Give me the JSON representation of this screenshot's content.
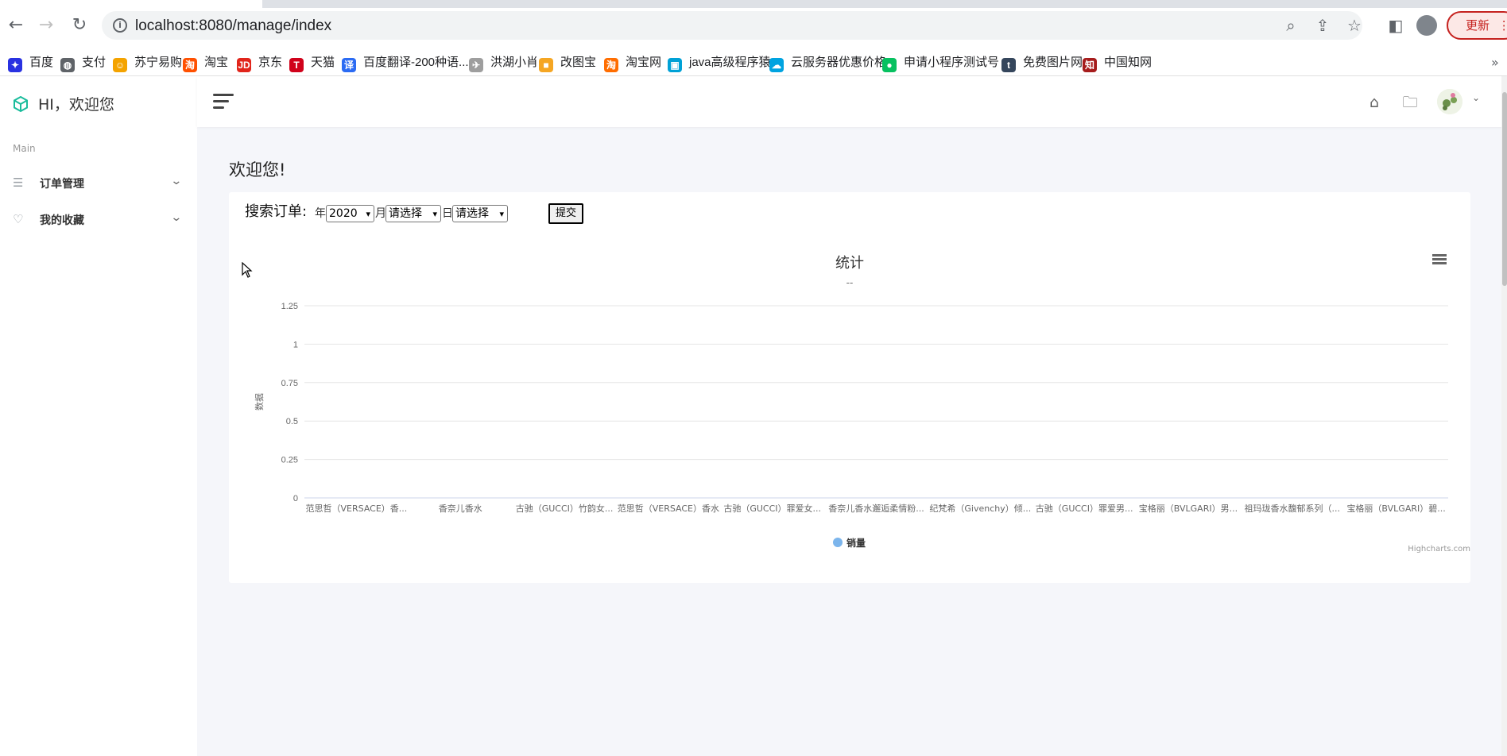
{
  "browser": {
    "url": "localhost:8080/manage/index",
    "update_label": "更新"
  },
  "bookmarks": [
    {
      "label": "百度",
      "icon": "baidu-icon",
      "color": "#2932e1",
      "glyph": "✦"
    },
    {
      "label": "支付",
      "icon": "globe-icon",
      "color": "#5f6368",
      "glyph": "◍"
    },
    {
      "label": "苏宁易购",
      "icon": "suning-icon",
      "color": "#f4a300",
      "glyph": "☺"
    },
    {
      "label": "淘宝",
      "icon": "taobao-icon",
      "color": "#ff5000",
      "glyph": "淘"
    },
    {
      "label": "京东",
      "icon": "jd-icon",
      "color": "#e1251b",
      "glyph": "JD"
    },
    {
      "label": "天猫",
      "icon": "tmall-icon",
      "color": "#d0021b",
      "glyph": "T"
    },
    {
      "label": "百度翻译-200种语...",
      "icon": "translate-icon",
      "color": "#2b6bf3",
      "glyph": "译"
    },
    {
      "label": "洪湖小肖",
      "icon": "bird-icon",
      "color": "#9e9e9e",
      "glyph": "✈"
    },
    {
      "label": "改图宝",
      "icon": "gaitubao-icon",
      "color": "#f5a623",
      "glyph": "■"
    },
    {
      "label": "淘宝网",
      "icon": "taobao-net-icon",
      "color": "#ff6d00",
      "glyph": "淘"
    },
    {
      "label": "java高级程序猿",
      "icon": "bilibili-icon",
      "color": "#00a1d6",
      "glyph": "▣"
    },
    {
      "label": "云服务器优惠价格",
      "icon": "cloud-icon",
      "color": "#00a3e0",
      "glyph": "☁"
    },
    {
      "label": "申请小程序测试号",
      "icon": "wechat-icon",
      "color": "#07c160",
      "glyph": "●"
    },
    {
      "label": "免费图片网",
      "icon": "tumblr-icon",
      "color": "#35465c",
      "glyph": "t"
    },
    {
      "label": "中国知网",
      "icon": "cnki-icon",
      "color": "#a61c1c",
      "glyph": "知"
    }
  ],
  "sidebar": {
    "brand": "HI，欢迎您",
    "section": "Main",
    "items": [
      {
        "label": "订单管理"
      },
      {
        "label": "我的收藏"
      }
    ]
  },
  "main": {
    "welcome": "欢迎您!",
    "search": {
      "label": "搜索订单:",
      "year_label": "年",
      "year_value": "2020",
      "month_label": "月",
      "month_value": "请选择",
      "day_label": "日",
      "day_value": "请选择",
      "submit_label": "提交"
    }
  },
  "chart_data": {
    "type": "bar",
    "title": "统计",
    "subtitle": "--",
    "ylabel": "数据",
    "xlabel": "",
    "ylim": [
      0,
      1.25
    ],
    "yticks": [
      "0",
      "0.25",
      "0.5",
      "0.75",
      "1",
      "1.25"
    ],
    "categories": [
      "范思哲（VERSACE）香...",
      "香奈儿香水",
      "古驰（GUCCI）竹韵女...",
      "范思哲（VERSACE）香水",
      "古驰（GUCCI）罪爱女...",
      "香奈儿香水邂逅柔情粉...",
      "纪梵希（Givenchy）倾...",
      "古驰（GUCCI）罪爱男...",
      "宝格丽（BVLGARI）男...",
      "祖玛珑香水馥郁系列（...",
      "宝格丽（BVLGARI）碧..."
    ],
    "series": [
      {
        "name": "销量",
        "values": [
          0,
          0,
          0,
          0,
          0,
          0,
          0,
          0,
          0,
          0,
          0
        ],
        "color": "#7cb5ec"
      }
    ],
    "grid": true,
    "legend": "bottom-center",
    "credits": "Highcharts.com"
  }
}
